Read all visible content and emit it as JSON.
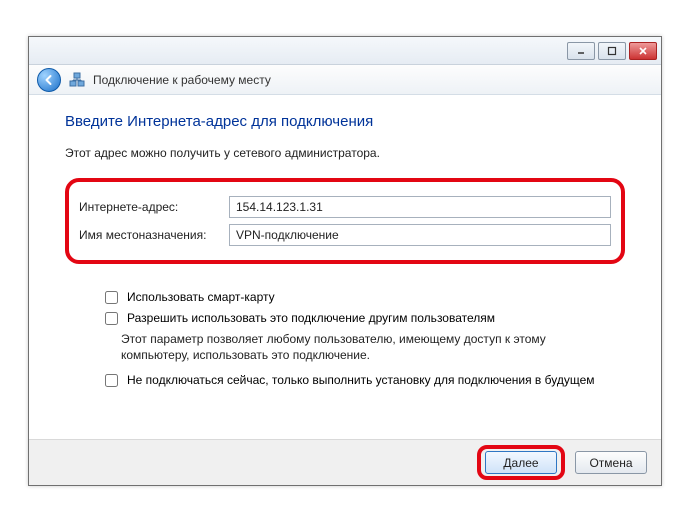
{
  "window": {
    "title": "Подключение к рабочему месту"
  },
  "heading": "Введите Интернета-адрес для подключения",
  "subtext": "Этот адрес можно получить у сетевого администратора.",
  "form": {
    "address_label": "Интернете-адрес:",
    "address_value": "154.14.123.1.31",
    "name_label": "Имя местоназначения:",
    "name_value": "VPN-подключение"
  },
  "options": {
    "smartcard": "Использовать смарт-карту",
    "allow_others": "Разрешить использовать это подключение другим пользователям",
    "allow_others_desc": "Этот параметр позволяет любому пользователю, имеющему доступ к этому компьютеру, использовать это подключение.",
    "dont_connect": "Не подключаться сейчас, только выполнить установку для подключения в будущем"
  },
  "buttons": {
    "next": "Далее",
    "cancel": "Отмена"
  }
}
